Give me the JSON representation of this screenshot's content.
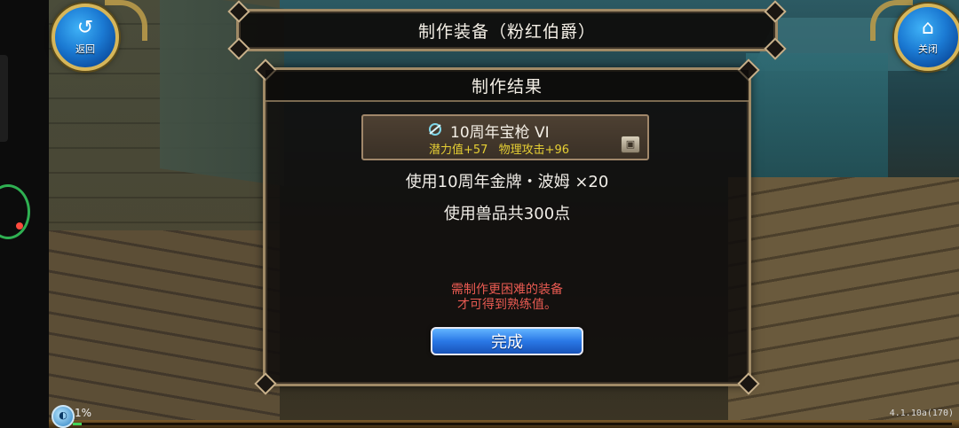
{
  "header": {
    "back_label": "返回",
    "close_label": "关闭",
    "title": "制作装备（粉红伯爵）"
  },
  "dialog": {
    "title": "制作结果",
    "item": {
      "icon": "weapon-icon",
      "name": "10周年宝枪 VI",
      "stats": [
        "潜力值+57",
        "物理攻击+96"
      ],
      "side_icon": "chest-icon"
    },
    "costs": [
      "使用10周年金牌・波姆 ×20",
      "使用兽品共300点"
    ],
    "notice": [
      "需制作更困难的装备",
      "才可得到熟练值。"
    ],
    "done_label": "完成"
  },
  "status": {
    "exp_percent": "1%",
    "exp_fraction": 0.01,
    "version": "4.1.10a(170)"
  },
  "colors": {
    "accent_blue": "#2a78e6",
    "notice_red": "#ea5b52",
    "stat_yellow": "#e6cf34",
    "frame_gold": "#a08a66"
  }
}
